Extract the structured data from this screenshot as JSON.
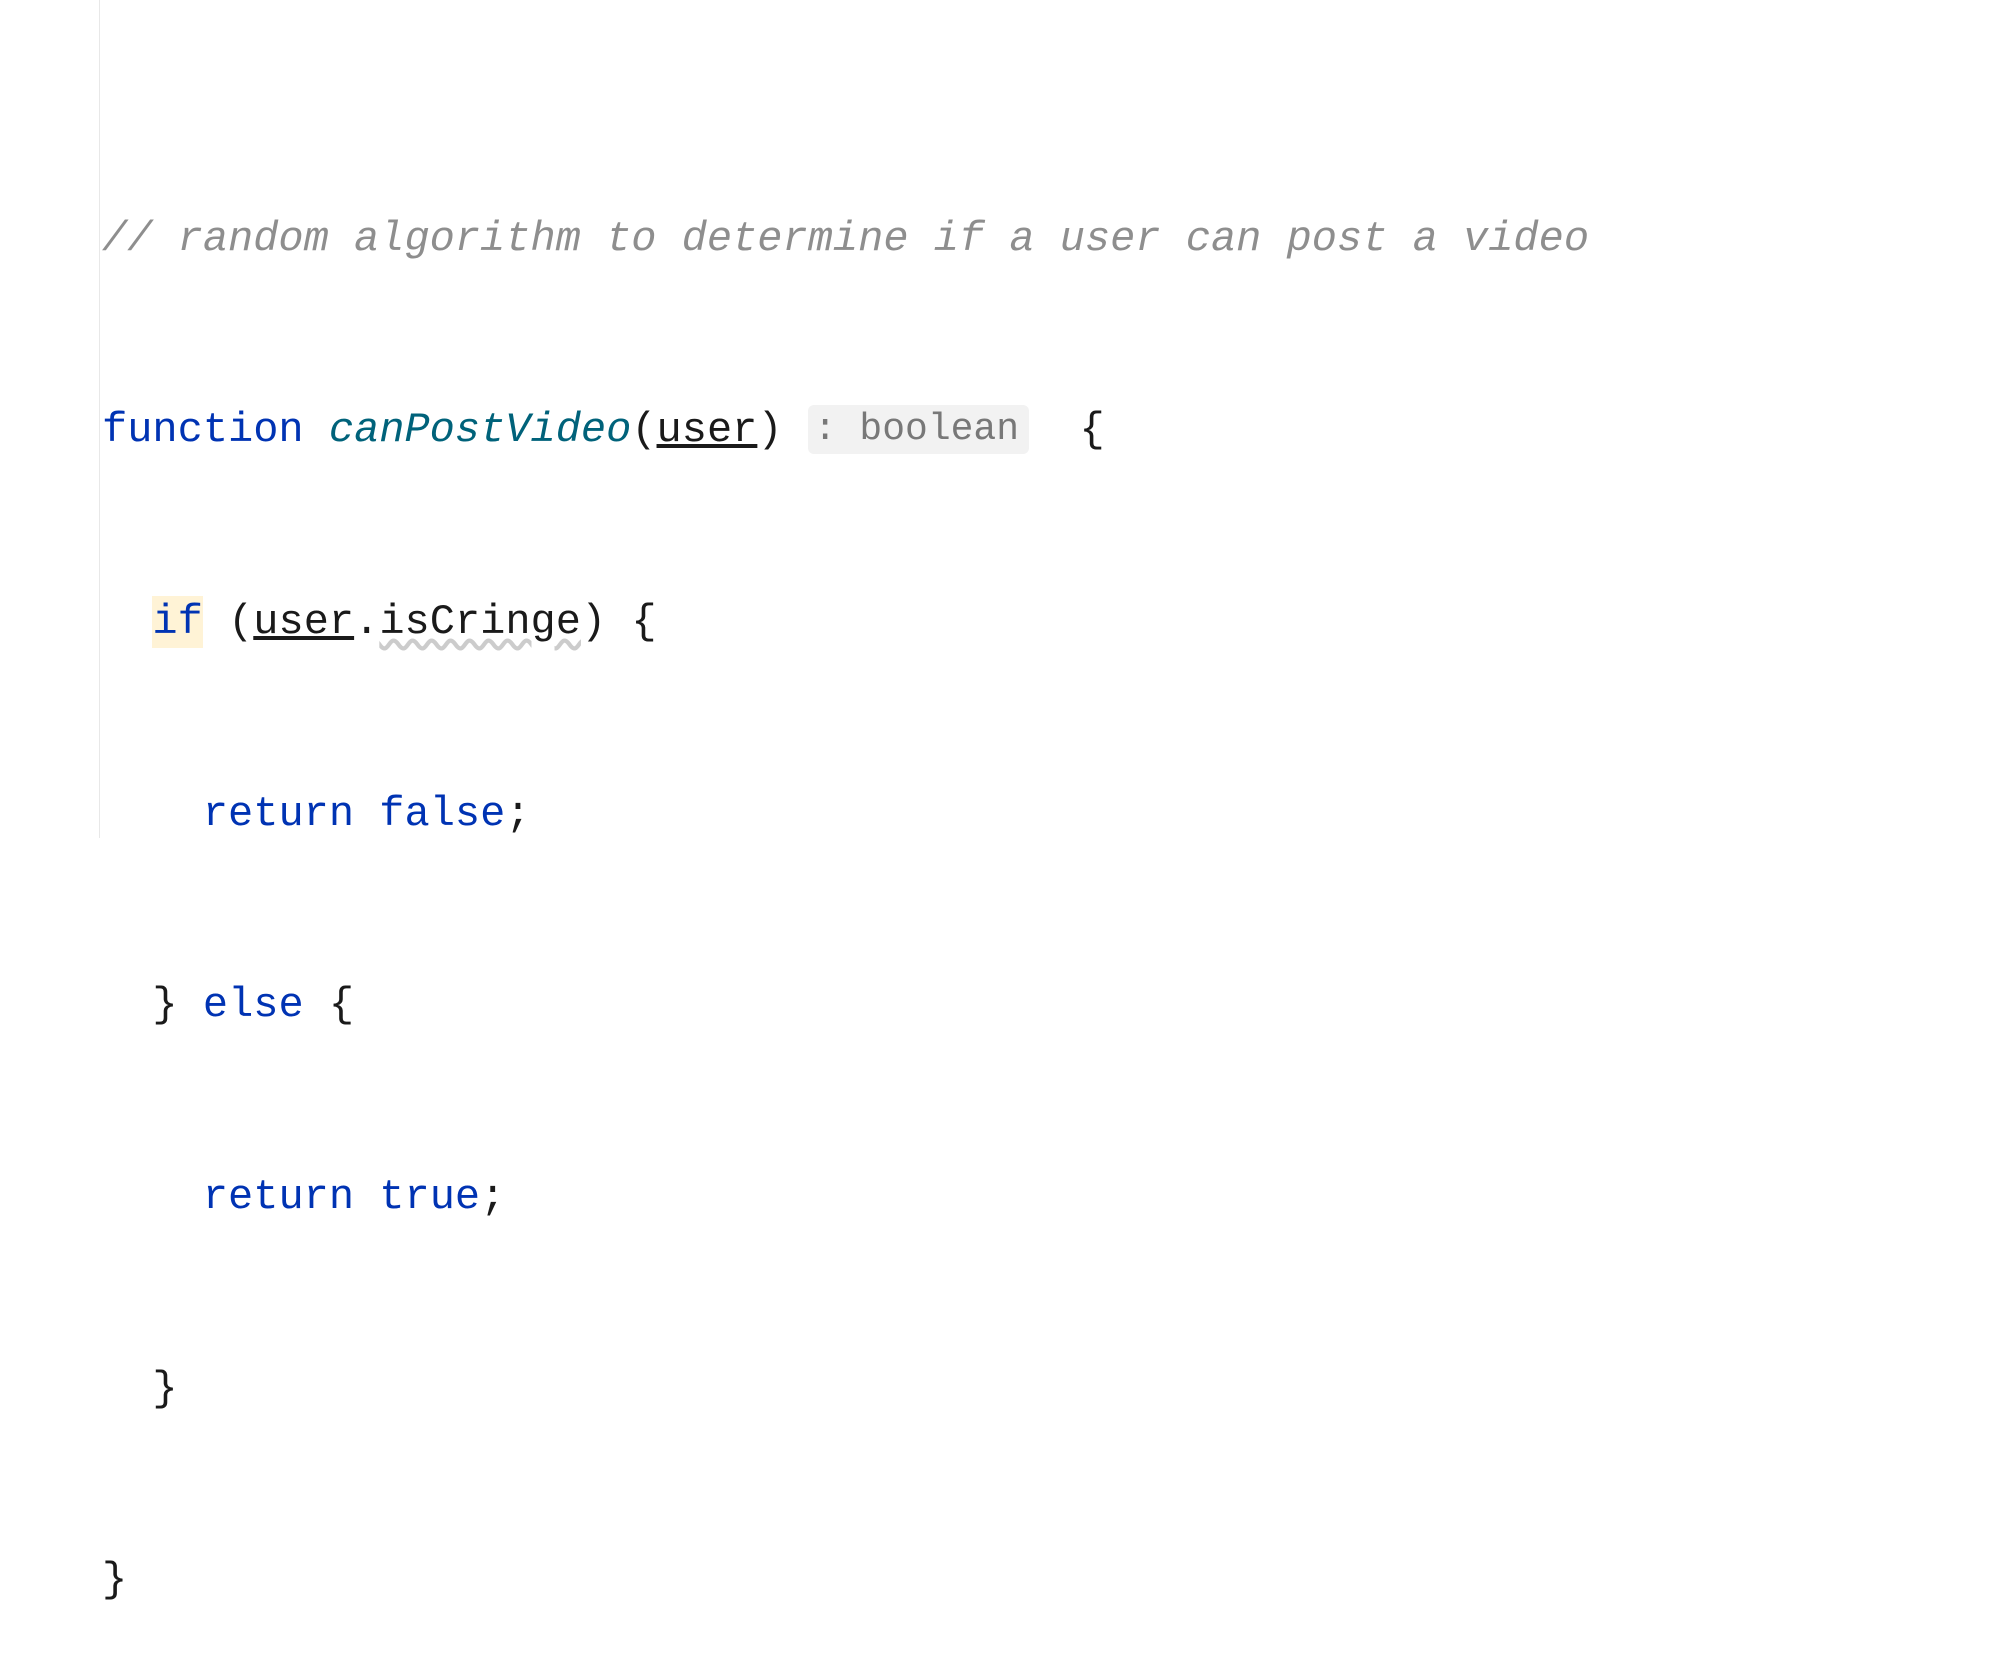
{
  "code": {
    "line1": {
      "comment": "// random algorithm to determine if a user can post a video"
    },
    "line2": {
      "keyword_function": "function",
      "function_name": "canPostVideo",
      "open_paren": "(",
      "param": "user",
      "close_paren": ")",
      "type_hint": ": boolean",
      "open_brace": "{"
    },
    "line3": {
      "keyword_if": "if",
      "open_paren": "(",
      "obj": "user",
      "dot": ".",
      "prop": "isCringe",
      "close_paren": ")",
      "open_brace": "{"
    },
    "line4": {
      "keyword_return": "return",
      "value": "false",
      "semi": ";"
    },
    "line5": {
      "close_brace": "}",
      "keyword_else": "else",
      "open_brace": "{"
    },
    "line6": {
      "keyword_return": "return",
      "value": "true",
      "semi": ";"
    },
    "line7": {
      "close_brace": "}"
    },
    "line8": {
      "close_brace": "}"
    }
  }
}
